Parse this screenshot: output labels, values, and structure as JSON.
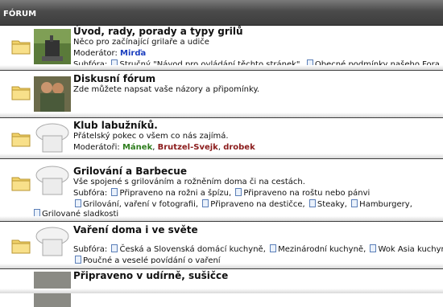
{
  "header": {
    "title": "FÓRUM"
  },
  "forums": [
    {
      "title": "Úvod, rady, porady a typy grilů",
      "description": "Něco pro začínající grilaře a udiče",
      "moderator_label": "Moderátor:",
      "moderators": [
        "Mirďa"
      ],
      "subforums_label": "Subfóra:",
      "subforums": [
        "Stručný \"Návod pro ovládání těchto stránek\"",
        "Obecné podmínky našeho Fora"
      ]
    },
    {
      "title": "Diskusní fórum",
      "description": "Zde můžete napsat vaše názory a připomínky."
    },
    {
      "title": "Klub labužníků.",
      "description": "Přátelský pokec o všem co nás zajímá.",
      "moderator_label": "Moderátoři:",
      "moderators": [
        "Mánek",
        "Brutzel-Svejk",
        "drobek"
      ],
      "moderator_sep": ", "
    },
    {
      "title": "Grilování a Barbecue",
      "description": "Vše spojené s grilováním a rožněním doma či na cestách.",
      "subforums_label": "Subfóra:",
      "subforums": [
        "Připraveno na rožni a špízu",
        "Připraveno na roštu nebo pánvi",
        "Grilování, vaření v fotografii",
        "Připraveno na destičce",
        "Steaky",
        "Hamburgery",
        "Grilované sladkosti"
      ]
    },
    {
      "title": "Vaření doma i ve světe",
      "subforums_label": "Subfóra:",
      "subforums": [
        "Česká a Slovenská domácí kuchyně",
        "Mezinárodní kuchyně",
        "Wok Asia kuchyně",
        "Poučné a veselé povídání o vaření"
      ]
    },
    {
      "title": "Připraveno v udírně, sušičce"
    }
  ]
}
